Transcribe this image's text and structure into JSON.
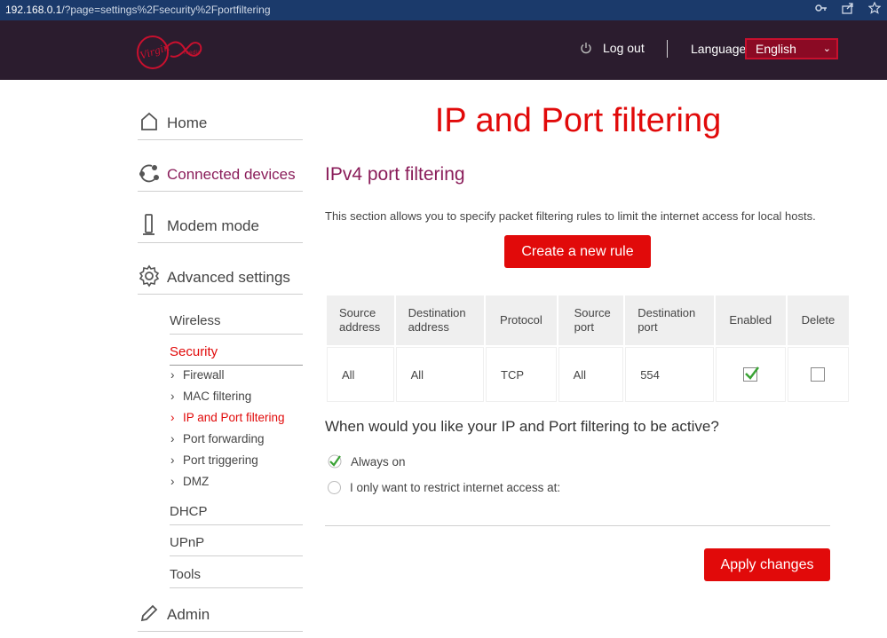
{
  "browser": {
    "url_host": "192.168.0.1",
    "url_path": "/?page=settings%2Fsecurity%2Fportfiltering"
  },
  "header": {
    "logo_text": "Virgin",
    "logo_sub": "media",
    "logout_label": "Log out",
    "language_label": "Language",
    "language_value": "English",
    "brand_color": "#c8102e"
  },
  "sidebar": {
    "main": [
      {
        "label": "Home",
        "icon": "home-icon"
      },
      {
        "label": "Connected devices",
        "icon": "devices-icon"
      },
      {
        "label": "Modem mode",
        "icon": "modem-icon"
      },
      {
        "label": "Advanced settings",
        "icon": "gear-icon"
      },
      {
        "label": "Admin",
        "icon": "pencil-icon"
      }
    ],
    "sub": [
      {
        "label": "Wireless"
      },
      {
        "label": "Security"
      },
      {
        "label": "DHCP"
      },
      {
        "label": "UPnP"
      },
      {
        "label": "Tools"
      }
    ],
    "security_items": [
      {
        "label": "Firewall"
      },
      {
        "label": "MAC filtering"
      },
      {
        "label": "IP and Port filtering"
      },
      {
        "label": "Port forwarding"
      },
      {
        "label": "Port triggering"
      },
      {
        "label": "DMZ"
      }
    ]
  },
  "main": {
    "title": "IP and Port filtering",
    "section_title": "IPv4 port filtering",
    "description": "This section allows you to specify packet filtering rules to limit the internet access for local hosts.",
    "create_button": "Create a new rule",
    "table": {
      "headers": [
        "Source\naddress",
        "Destination\naddress",
        "Protocol",
        "Source\nport",
        "Destination\nport",
        "Enabled",
        "Delete"
      ],
      "rows": [
        {
          "source_address": "All",
          "destination_address": "All",
          "protocol": "TCP",
          "source_port": "All",
          "destination_port": "554",
          "enabled": true,
          "delete": false
        }
      ]
    },
    "question": "When would you like your IP and Port filtering to be active?",
    "options": [
      {
        "label": "Always on",
        "selected": true
      },
      {
        "label": "I only want to restrict internet access at:",
        "selected": false
      }
    ],
    "apply_button": "Apply changes"
  }
}
